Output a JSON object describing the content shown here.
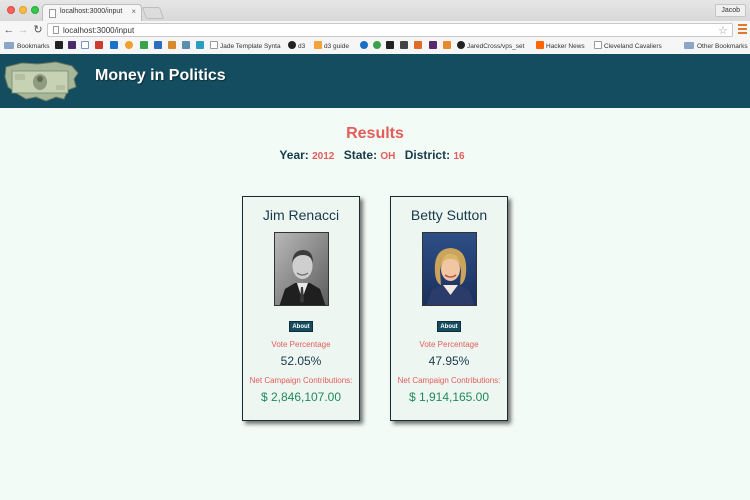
{
  "browser": {
    "tab_title": "localhost:3000/input",
    "tab_close": "×",
    "user": "Jacob",
    "url": "localhost:3000/input",
    "bookmarks": [
      {
        "label": "Bookmarks",
        "icon": "folder-icon"
      },
      {
        "label": "Jade Template Synta",
        "icon": "page-icon"
      },
      {
        "label": "d3",
        "icon": "github-icon"
      },
      {
        "label": "d3 guide",
        "icon": "d3-icon"
      },
      {
        "label": "JaredCross/vps_set",
        "icon": "github-icon"
      },
      {
        "label": "Hacker News",
        "icon": "y-icon"
      },
      {
        "label": "Cleveland Cavaliers",
        "icon": "page-icon"
      },
      {
        "label": "Other Bookmarks",
        "icon": "folder-icon"
      }
    ]
  },
  "site": {
    "title": "Money in Politics"
  },
  "results": {
    "heading": "Results",
    "year_label": "Year:",
    "year": "2012",
    "state_label": "State:",
    "state": "OH",
    "district_label": "District:",
    "district": "16"
  },
  "candidates": [
    {
      "name": "Jim Renacci",
      "about": "About",
      "vote_label": "Vote Percentage",
      "vote_pct": "52.05%",
      "contrib_label": "Net Campaign Contributions:",
      "contrib": "$ 2,846,107.00"
    },
    {
      "name": "Betty Sutton",
      "about": "About",
      "vote_label": "Vote Percentage",
      "vote_pct": "47.95%",
      "contrib_label": "Net Campaign Contributions:",
      "contrib": "$ 1,914,165.00"
    }
  ],
  "colors": {
    "header_bg": "#154d60",
    "accent_red": "#e35d5b",
    "money_green": "#1e8a5c",
    "page_bg": "#f3fbf6"
  }
}
